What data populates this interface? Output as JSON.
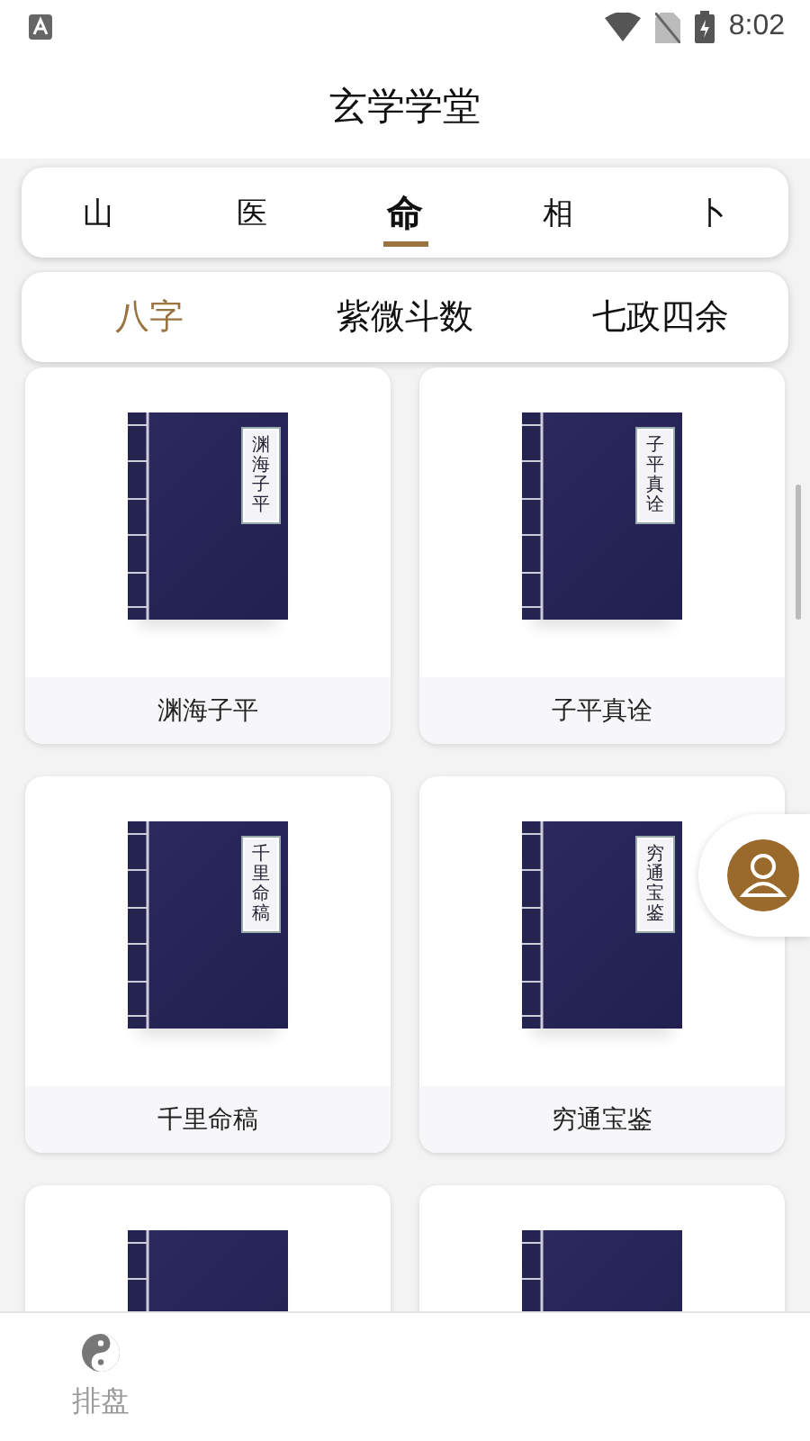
{
  "status_bar": {
    "time": "8:02"
  },
  "header": {
    "title": "玄学学堂"
  },
  "tabs": [
    {
      "label": "山",
      "selected": false
    },
    {
      "label": "医",
      "selected": false
    },
    {
      "label": "命",
      "selected": true
    },
    {
      "label": "相",
      "selected": false
    },
    {
      "label": "卜",
      "selected": false
    }
  ],
  "subtabs": [
    {
      "label": "八字",
      "selected": true
    },
    {
      "label": "紫微斗数",
      "selected": false
    },
    {
      "label": "七政四余",
      "selected": false
    }
  ],
  "books": [
    {
      "kind": "titled",
      "title": "渊海子平",
      "cover_title": "渊海子平"
    },
    {
      "kind": "titled",
      "title": "子平真诠",
      "cover_title": "子平真诠"
    },
    {
      "kind": "titled",
      "title": "千里命稿",
      "cover_title": "千里命稿"
    },
    {
      "kind": "titled",
      "title": "穷通宝鉴",
      "cover_title": "穷通宝鉴"
    },
    {
      "kind": "cover_only"
    },
    {
      "kind": "cover_only"
    }
  ],
  "bottom_nav": [
    {
      "label": "排盘"
    }
  ]
}
